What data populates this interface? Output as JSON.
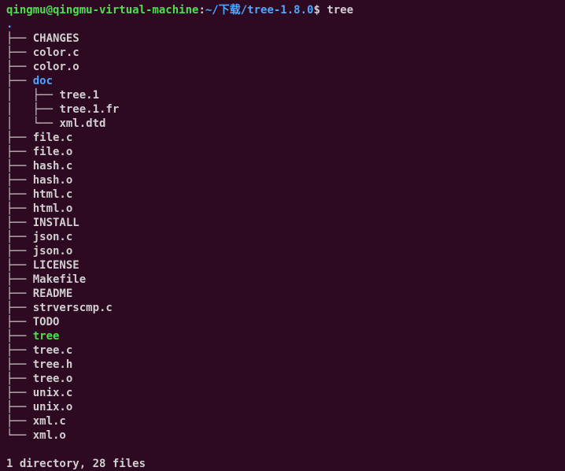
{
  "prompt": {
    "user_host": "qingmu@qingmu-virtual-machine",
    "colon": ":",
    "path": "~/下载/tree-1.8.0",
    "dollar": "$ ",
    "command": "tree"
  },
  "tree": {
    "root": ".",
    "entries": [
      {
        "prefix": "├── ",
        "name": "CHANGES",
        "type": "file"
      },
      {
        "prefix": "├── ",
        "name": "color.c",
        "type": "file"
      },
      {
        "prefix": "├── ",
        "name": "color.o",
        "type": "file"
      },
      {
        "prefix": "├── ",
        "name": "doc",
        "type": "dir"
      },
      {
        "prefix": "│   ├── ",
        "name": "tree.1",
        "type": "file"
      },
      {
        "prefix": "│   ├── ",
        "name": "tree.1.fr",
        "type": "file"
      },
      {
        "prefix": "│   └── ",
        "name": "xml.dtd",
        "type": "file"
      },
      {
        "prefix": "├── ",
        "name": "file.c",
        "type": "file"
      },
      {
        "prefix": "├── ",
        "name": "file.o",
        "type": "file"
      },
      {
        "prefix": "├── ",
        "name": "hash.c",
        "type": "file"
      },
      {
        "prefix": "├── ",
        "name": "hash.o",
        "type": "file"
      },
      {
        "prefix": "├── ",
        "name": "html.c",
        "type": "file"
      },
      {
        "prefix": "├── ",
        "name": "html.o",
        "type": "file"
      },
      {
        "prefix": "├── ",
        "name": "INSTALL",
        "type": "file"
      },
      {
        "prefix": "├── ",
        "name": "json.c",
        "type": "file"
      },
      {
        "prefix": "├── ",
        "name": "json.o",
        "type": "file"
      },
      {
        "prefix": "├── ",
        "name": "LICENSE",
        "type": "file"
      },
      {
        "prefix": "├── ",
        "name": "Makefile",
        "type": "file"
      },
      {
        "prefix": "├── ",
        "name": "README",
        "type": "file"
      },
      {
        "prefix": "├── ",
        "name": "strverscmp.c",
        "type": "file"
      },
      {
        "prefix": "├── ",
        "name": "TODO",
        "type": "file"
      },
      {
        "prefix": "├── ",
        "name": "tree",
        "type": "exec"
      },
      {
        "prefix": "├── ",
        "name": "tree.c",
        "type": "file"
      },
      {
        "prefix": "├── ",
        "name": "tree.h",
        "type": "file"
      },
      {
        "prefix": "├── ",
        "name": "tree.o",
        "type": "file"
      },
      {
        "prefix": "├── ",
        "name": "unix.c",
        "type": "file"
      },
      {
        "prefix": "├── ",
        "name": "unix.o",
        "type": "file"
      },
      {
        "prefix": "├── ",
        "name": "xml.c",
        "type": "file"
      },
      {
        "prefix": "└── ",
        "name": "xml.o",
        "type": "file"
      }
    ]
  },
  "summary": "1 directory, 28 files"
}
